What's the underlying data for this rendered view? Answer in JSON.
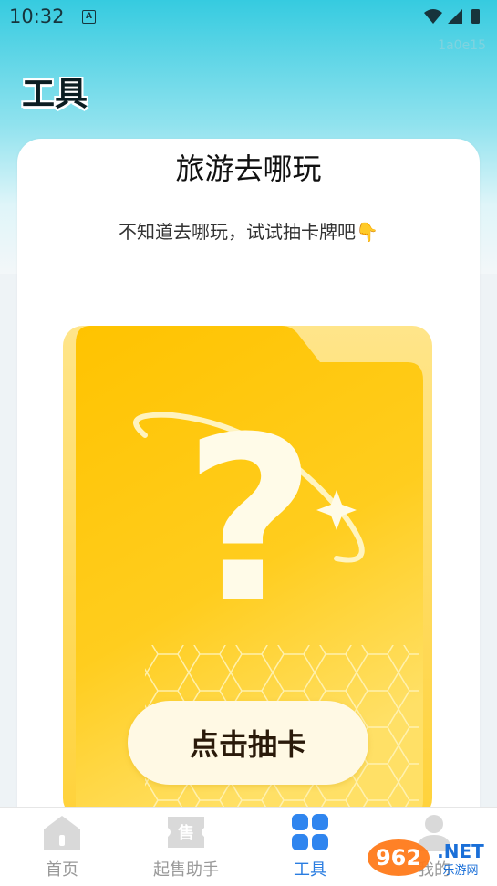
{
  "status_bar": {
    "time": "10:32"
  },
  "watermark": "1a0e15",
  "header": {
    "title": "工具"
  },
  "card": {
    "title": "旅游去哪玩",
    "subtitle": "不知道去哪玩，试试抽卡牌吧👇",
    "button_label": "点击抽卡"
  },
  "tabs": [
    {
      "label": "首页",
      "icon": "home-icon",
      "active": false
    },
    {
      "label": "起售助手",
      "icon": "sale-ticket-icon",
      "active": false
    },
    {
      "label": "工具",
      "icon": "grid-icon",
      "active": true
    },
    {
      "label": "我的",
      "icon": "user-icon",
      "active": false
    }
  ],
  "logo": {
    "text": "962.NET",
    "subtext": "乐游网"
  },
  "colors": {
    "accent": "#2a7de1",
    "card_yellow": "#ffc400",
    "header_cyan": "#36cbe0"
  }
}
